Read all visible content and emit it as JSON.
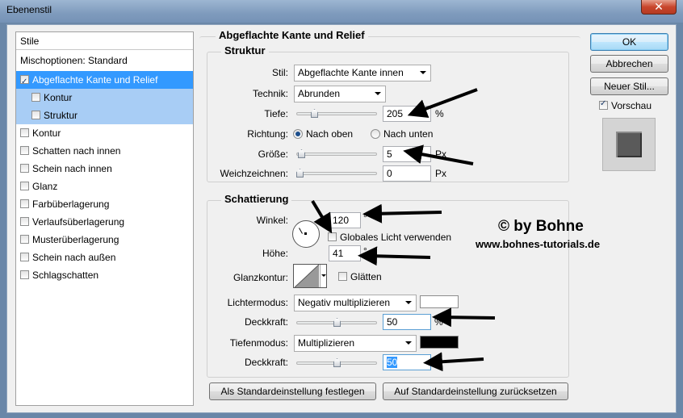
{
  "window": {
    "title": "Ebenenstil",
    "close_symbol": "✕"
  },
  "styles_list": {
    "header": "Stile",
    "blend_options": "Mischoptionen: Standard",
    "items": [
      {
        "label": "Abgeflachte Kante und Relief",
        "checked": true,
        "selected": true
      },
      {
        "label": "Kontur",
        "checked": false,
        "sub": true
      },
      {
        "label": "Struktur",
        "checked": false,
        "sub": true
      },
      {
        "label": "Kontur",
        "checked": false
      },
      {
        "label": "Schatten nach innen",
        "checked": false
      },
      {
        "label": "Schein nach innen",
        "checked": false
      },
      {
        "label": "Glanz",
        "checked": false
      },
      {
        "label": "Farbüberlagerung",
        "checked": false
      },
      {
        "label": "Verlaufsüberlagerung",
        "checked": false
      },
      {
        "label": "Musterüberlagerung",
        "checked": false
      },
      {
        "label": "Schein nach außen",
        "checked": false
      },
      {
        "label": "Schlagschatten",
        "checked": false
      }
    ]
  },
  "panel": {
    "title": "Abgeflachte Kante und Relief",
    "structure": {
      "title": "Struktur",
      "style_label": "Stil:",
      "style_value": "Abgeflachte Kante innen",
      "technique_label": "Technik:",
      "technique_value": "Abrunden",
      "depth_label": "Tiefe:",
      "depth_value": "205",
      "depth_unit": "%",
      "depth_level": 0.2,
      "direction_label": "Richtung:",
      "direction_up": "Nach oben",
      "direction_down": "Nach unten",
      "size_label": "Größe:",
      "size_value": "5",
      "size_unit": "Px",
      "size_level": 0.02,
      "soften_label": "Weichzeichnen:",
      "soften_value": "0",
      "soften_unit": "Px",
      "soften_level": 0.0
    },
    "shading": {
      "title": "Schattierung",
      "angle_label": "Winkel:",
      "angle_value": "120",
      "degree": "°",
      "global_light_label": "Globales Licht verwenden",
      "altitude_label": "Höhe:",
      "altitude_value": "41",
      "gloss_label": "Glanzkontur:",
      "smooth_label": "Glätten",
      "highlight_mode_label": "Lichtermodus:",
      "highlight_mode_value": "Negativ multiplizieren",
      "highlight_color": "#ffffff",
      "highlight_opacity_label": "Deckkraft:",
      "highlight_opacity_value": "50",
      "highlight_opacity_unit": "%",
      "highlight_level": 0.5,
      "shadow_mode_label": "Tiefenmodus:",
      "shadow_mode_value": "Multiplizieren",
      "shadow_color": "#000000",
      "shadow_opacity_label": "Deckkraft:",
      "shadow_opacity_value": "50",
      "shadow_level": 0.5
    },
    "make_default": "Als Standardeinstellung festlegen",
    "reset_default": "Auf Standardeinstellung zurücksetzen"
  },
  "buttons": {
    "ok": "OK",
    "cancel": "Abbrechen",
    "new_style": "Neuer Stil...",
    "preview_label": "Vorschau"
  },
  "watermark": {
    "line1": "© by Bohne",
    "line2": "www.bohnes-tutorials.de"
  }
}
